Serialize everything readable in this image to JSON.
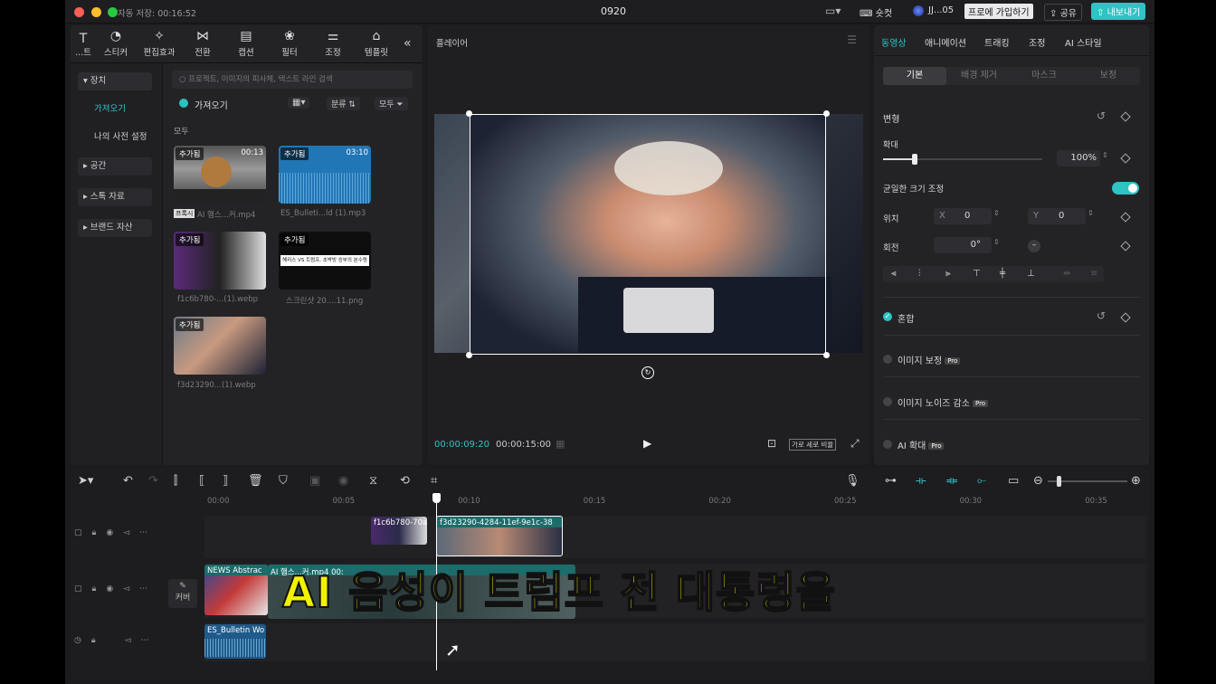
{
  "titlebar": {
    "autosave": "자동 저장: 00:16:52",
    "project_name": "0920",
    "shortcut_label": "숏컷",
    "user_label": "JJ...05",
    "join_pro_label": "프로에 가입하기",
    "share_label": "공유",
    "export_label": "내보내기"
  },
  "media_toolbar": {
    "items": [
      {
        "label": "...트",
        "icon": "text-icon"
      },
      {
        "label": "스티커",
        "icon": "sticker-icon"
      },
      {
        "label": "편집효과",
        "icon": "effects-icon"
      },
      {
        "label": "전환",
        "icon": "transition-icon"
      },
      {
        "label": "캡션",
        "icon": "caption-icon"
      },
      {
        "label": "필터",
        "icon": "filter-icon"
      },
      {
        "label": "조정",
        "icon": "adjust-icon"
      },
      {
        "label": "템플릿",
        "icon": "template-icon"
      }
    ]
  },
  "sidebar": {
    "items": [
      {
        "label": "▾ 장치"
      },
      {
        "label": "가져오기"
      },
      {
        "label": "나의 사전 설정"
      },
      {
        "label": "▸ 공간"
      },
      {
        "label": "▸ 스톡 자료"
      },
      {
        "label": "▸ 브랜드 자산"
      }
    ]
  },
  "media": {
    "search_placeholder": "프로젝트, 이미지의 피사체, 텍스트 라인 검색",
    "import_label": "가져오기",
    "sort_label": "분류",
    "filter_label": "모두",
    "section_label": "모두",
    "items": [
      {
        "badge": "추가됨",
        "duration": "00:13",
        "caption": "AI 햄스...커.mp4",
        "tag": "프록시"
      },
      {
        "badge": "추가됨",
        "duration": "03:10",
        "caption": "ES_Bulleti...ld (1).mp3"
      },
      {
        "badge": "추가됨",
        "caption": "f1c6b780-...(1).webp"
      },
      {
        "badge": "추가됨",
        "caption": "스크린샷 20....11.png",
        "inner_text": "해리스 VS 트럼프, 초박빙 승부의 분수령"
      },
      {
        "badge": "추가됨",
        "caption": "f3d23290...(1).webp"
      }
    ]
  },
  "player": {
    "title": "플레이어",
    "current_time": "00:00:09:20",
    "total_time": "00:00:15:00",
    "ratio_label": "가로 세로 비율"
  },
  "inspector": {
    "tabs": [
      "동영상",
      "애니메이션",
      "트래킹",
      "조정",
      "AI 스타일"
    ],
    "subtabs": [
      "기본",
      "배경 제거",
      "마스크",
      "보정"
    ],
    "transform_label": "변형",
    "scale_label": "확대",
    "scale_value": "100%",
    "scale_fraction": 0.1,
    "uniform_label": "균일한 크기 조정",
    "position_label": "위치",
    "x_label": "X",
    "x_value": "0",
    "y_label": "Y",
    "y_value": "0",
    "rotation_label": "회전",
    "rotation_value": "0°",
    "blend_label": "혼합",
    "enhance_label": "이미지 보정",
    "denoise_label": "이미지 노이즈 감소",
    "upscale_label": "AI 확대",
    "pro_badge": "Pro"
  },
  "timeline": {
    "ticks": [
      "00:00",
      "00:05",
      "00:10",
      "00:15",
      "00:20",
      "00:25",
      "00:30",
      "00:35"
    ],
    "clips": [
      {
        "label": "f1c6b780-70a"
      },
      {
        "label": "f3d23290-4284-11ef-9e1c-38"
      },
      {
        "label": "NEWS Abstrac"
      },
      {
        "label": "AI 햄스...커.mp4  00:"
      },
      {
        "label": "ES_Bulletin Wo"
      }
    ],
    "cover_label": "커버"
  },
  "subtitle": "AI 음성이 트럼프 전 대통령을",
  "colors": {
    "accent": "#27c2c2",
    "subtitle_fill": "#f2f200",
    "clip_teal": "#1d6b6b"
  }
}
